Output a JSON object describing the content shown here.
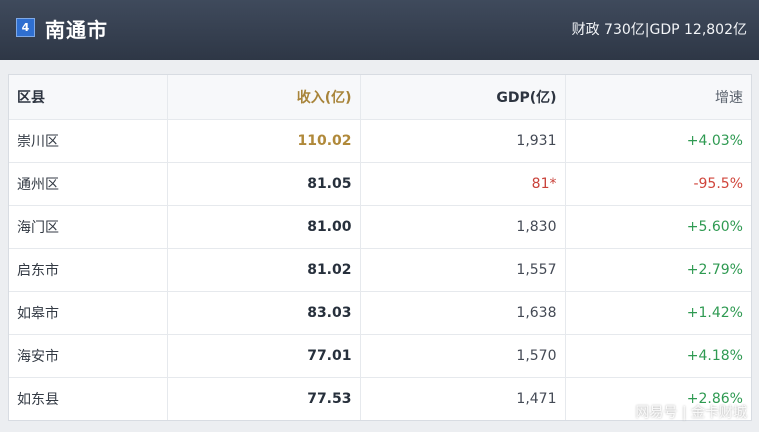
{
  "header": {
    "rank": "4",
    "city": "南通市",
    "summary": "财政 730亿|GDP 12,802亿"
  },
  "table": {
    "columns": [
      "区县",
      "收入(亿)",
      "GDP(亿)",
      "增速"
    ],
    "rows": [
      {
        "name": "崇川区",
        "income": "110.02",
        "gdp": "1,931",
        "growth": "+4.03%",
        "trend": "pos",
        "top": true
      },
      {
        "name": "通州区",
        "income": "81.05",
        "gdp": "81*",
        "growth": "-95.5%",
        "trend": "neg",
        "flag": true
      },
      {
        "name": "海门区",
        "income": "81.00",
        "gdp": "1,830",
        "growth": "+5.60%",
        "trend": "pos"
      },
      {
        "name": "启东市",
        "income": "81.02",
        "gdp": "1,557",
        "growth": "+2.79%",
        "trend": "pos"
      },
      {
        "name": "如皋市",
        "income": "83.03",
        "gdp": "1,638",
        "growth": "+1.42%",
        "trend": "pos"
      },
      {
        "name": "海安市",
        "income": "77.01",
        "gdp": "1,570",
        "growth": "+4.18%",
        "trend": "pos"
      },
      {
        "name": "如东县",
        "income": "77.53",
        "gdp": "1,471",
        "growth": "+2.86%",
        "trend": "pos"
      }
    ]
  },
  "colors": {
    "header_bg": "#2e3746",
    "badge": "#2f6fd0",
    "income_accent": "#b0893a",
    "positive": "#2f9a52",
    "negative": "#d0453b"
  },
  "watermark": "网易号 | 金卡财城"
}
